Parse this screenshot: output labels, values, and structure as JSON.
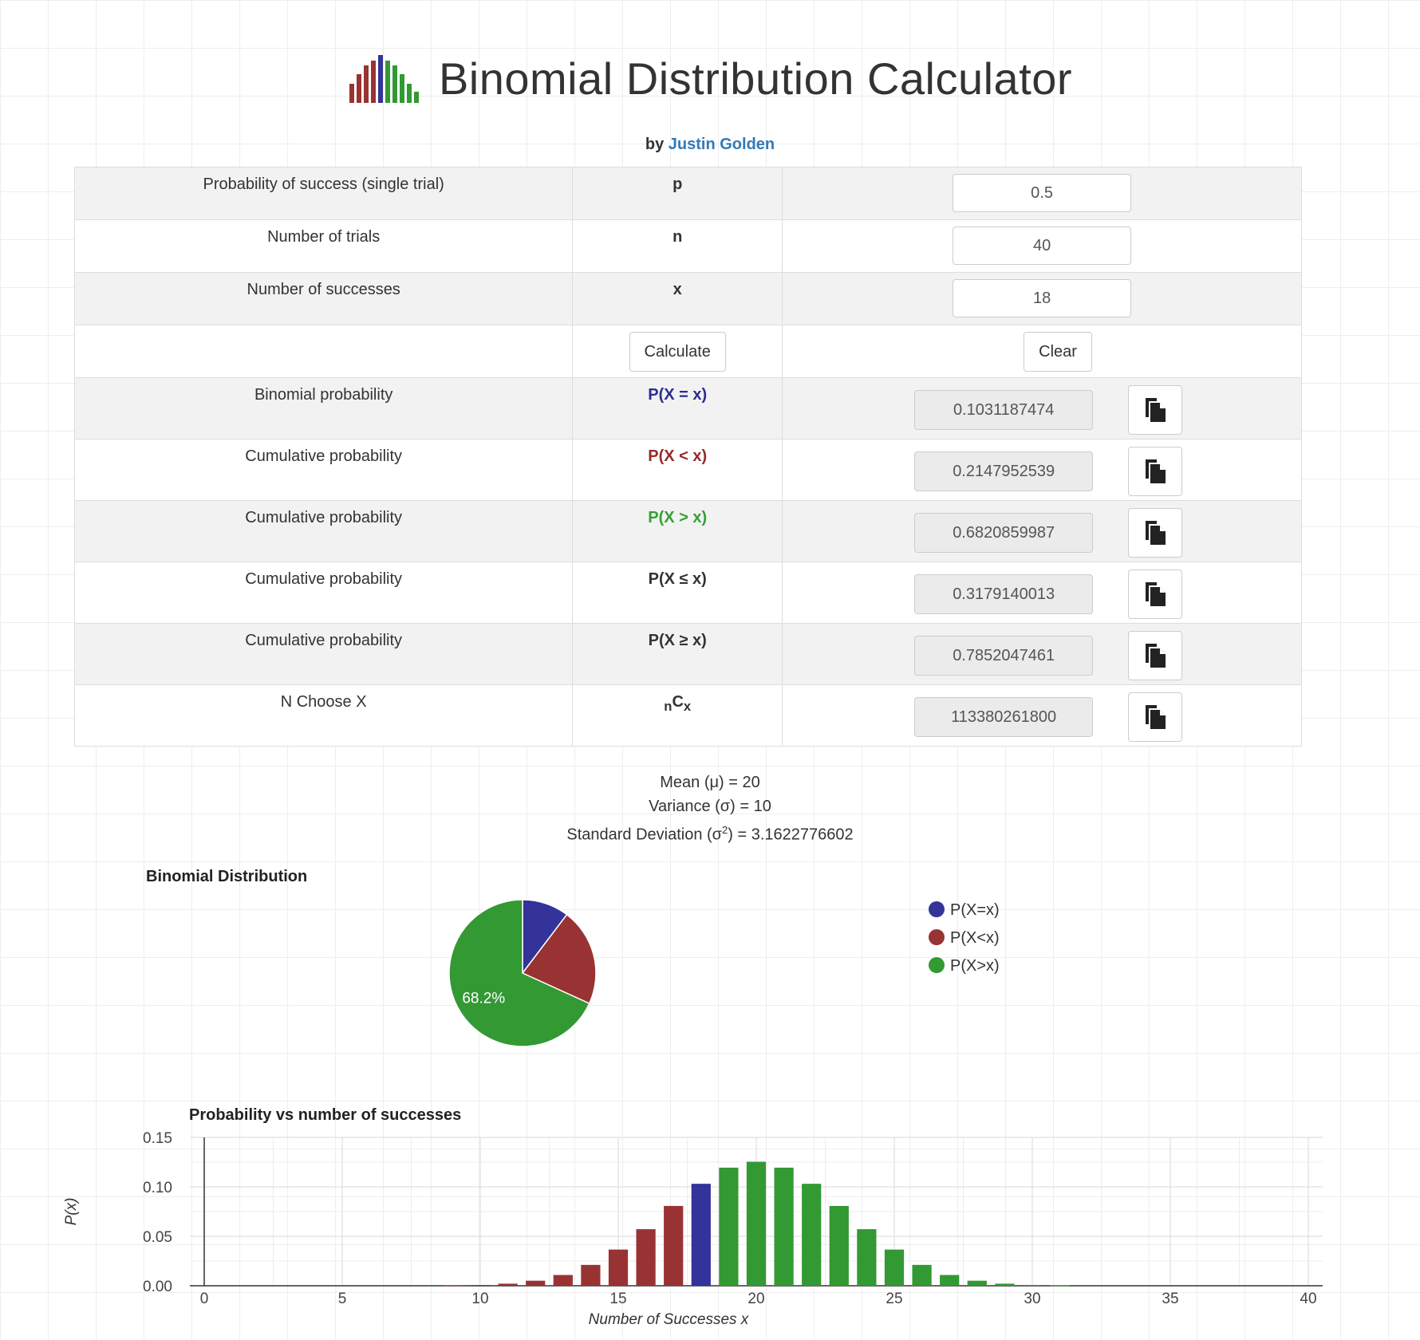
{
  "header": {
    "title": "Binomial Distribution Calculator",
    "by": "by",
    "author": "Justin Golden"
  },
  "inputs": [
    {
      "label": "Probability of success (single trial)",
      "symbol": "p",
      "value": "0.5"
    },
    {
      "label": "Number of trials",
      "symbol": "n",
      "value": "40"
    },
    {
      "label": "Number of successes",
      "symbol": "x",
      "value": "18"
    }
  ],
  "buttons": {
    "calculate": "Calculate",
    "clear": "Clear"
  },
  "results": [
    {
      "label": "Binomial probability",
      "symbol": "P(X = x)",
      "value": "0.1031187474",
      "color": "#2c2c8f"
    },
    {
      "label": "Cumulative probability",
      "symbol": "P(X < x)",
      "value": "0.2147952539",
      "color": "#942b2b"
    },
    {
      "label": "Cumulative probability",
      "symbol": "P(X > x)",
      "value": "0.6820859987",
      "color": "#33a033"
    },
    {
      "label": "Cumulative probability",
      "symbol": "P(X ≤ x)",
      "value": "0.3179140013",
      "color": "#222222"
    },
    {
      "label": "Cumulative probability",
      "symbol": "P(X ≥ x)",
      "value": "0.7852047461",
      "color": "#222222"
    }
  ],
  "nchoosex": {
    "label": "N Choose X",
    "sub_n": "n",
    "main": "C",
    "sub_x": "x",
    "value": "113380261800"
  },
  "copy_icon": "copy-icon",
  "stats": {
    "mean": "Mean (μ) = 20",
    "variance": "Variance (σ) = 10",
    "sd_prefix": "Standard Deviation (σ",
    "sd_sup": "2",
    "sd_suffix": ") = 3.1622776602"
  },
  "chart_data": [
    {
      "type": "pie",
      "title": "Binomial Distribution",
      "labels": [
        "P(X=x)",
        "P(X<x)",
        "P(X>x)"
      ],
      "values": [
        0.1031187474,
        0.2147952539,
        0.6820859987
      ],
      "colors": [
        "#333399",
        "#993333",
        "#339933"
      ],
      "slice_labels": [
        "",
        "",
        "68.2%"
      ],
      "legend": "right"
    },
    {
      "type": "bar",
      "title": "Probability vs number of successes",
      "xlabel": "Number of Successes x",
      "ylabel": "P(x)",
      "xlim": [
        0,
        40
      ],
      "ylim": [
        0,
        0.15
      ],
      "xticks": [
        0,
        5,
        10,
        15,
        20,
        25,
        30,
        35,
        40
      ],
      "yticks": [
        "0.00",
        "0.05",
        "0.10",
        "0.15"
      ],
      "grid": true,
      "x": [
        9,
        10,
        11,
        12,
        13,
        14,
        15,
        16,
        17,
        18,
        19,
        20,
        21,
        22,
        23,
        24,
        25,
        26,
        27,
        28,
        29,
        30,
        31
      ],
      "values": [
        0.0003,
        0.0008,
        0.0021,
        0.0051,
        0.0109,
        0.0211,
        0.0366,
        0.0572,
        0.0807,
        0.1031,
        0.1194,
        0.1254,
        0.1194,
        0.1031,
        0.0807,
        0.0572,
        0.0366,
        0.0211,
        0.0109,
        0.0051,
        0.0021,
        0.0008,
        0.0003
      ],
      "colors": {
        "less": "#993333",
        "equal": "#333399",
        "greater": "#339933"
      },
      "x_selected": 18
    }
  ]
}
